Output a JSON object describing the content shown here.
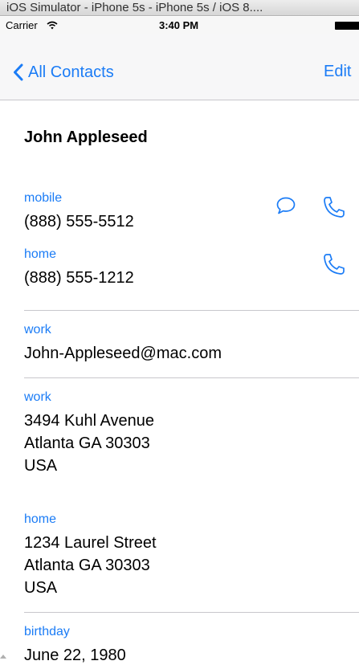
{
  "window": {
    "title": "iOS Simulator - iPhone 5s - iPhone 5s / iOS 8...."
  },
  "status_bar": {
    "carrier": "Carrier",
    "time": "3:40 PM"
  },
  "nav": {
    "back_label": "All Contacts",
    "edit_label": "Edit"
  },
  "contact": {
    "name": "John Appleseed",
    "fields": [
      {
        "label": "mobile",
        "value": "(888) 555-5512"
      },
      {
        "label": "home",
        "value": "(888) 555-1212"
      },
      {
        "label": "work",
        "value": "John-Appleseed@mac.com"
      },
      {
        "label": "work",
        "value": "3494 Kuhl Avenue\nAtlanta GA 30303\nUSA"
      },
      {
        "label": "home",
        "value": "1234 Laurel Street\nAtlanta GA 30303\nUSA"
      },
      {
        "label": "birthday",
        "value": "June 22, 1980"
      }
    ]
  },
  "colors": {
    "accent": "#1b7cf6",
    "separator": "#c8c7cc",
    "nav_background": "#f7f7f8"
  },
  "icons": {
    "message": "speech-bubble-icon",
    "call": "phone-icon",
    "back": "chevron-left-icon"
  }
}
